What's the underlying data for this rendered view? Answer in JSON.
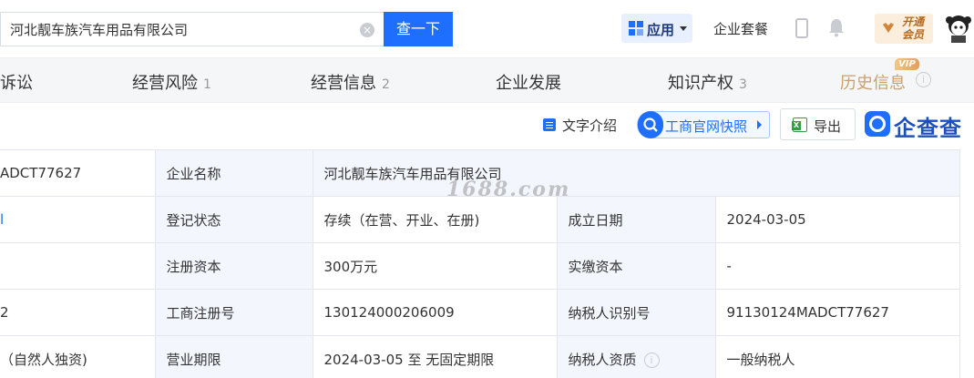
{
  "search": {
    "value": "河北靓车族汽车用品有限公司",
    "button": "查一下"
  },
  "header": {
    "app_label": "应用",
    "package_label": "企业套餐",
    "vip_label": "开通会员"
  },
  "tabs": [
    {
      "label": "诉讼",
      "count": ""
    },
    {
      "label": "经营风险",
      "count": "1"
    },
    {
      "label": "经营信息",
      "count": "2"
    },
    {
      "label": "企业发展",
      "count": ""
    },
    {
      "label": "知识产权",
      "count": "3"
    },
    {
      "label": "历史信息",
      "count": ""
    }
  ],
  "vip_tag": "VIP",
  "toolbar": {
    "text_intro": "文字介绍",
    "snapshot": "工商官网快照",
    "export": "导出",
    "brand": "企查查"
  },
  "watermark": "1688.com",
  "table": {
    "left_col": [
      "ADCT77627",
      "",
      "",
      "2",
      "（自然人独资)"
    ],
    "rows": [
      {
        "label1": "企业名称",
        "value1": "河北靓车族汽车用品有限公司",
        "label2": "",
        "value2": ""
      },
      {
        "label1": "登记状态",
        "value1": "存续（在营、开业、在册)",
        "label2": "成立日期",
        "value2": "2024-03-05"
      },
      {
        "label1": "注册资本",
        "value1": "300万元",
        "label2": "实缴资本",
        "value2": "-"
      },
      {
        "label1": "工商注册号",
        "value1": "130124000206009",
        "label2": "纳税人识别号",
        "value2": "91130124MADCT77627"
      },
      {
        "label1": "营业期限",
        "value1": "2024-03-05 至 无固定期限",
        "label2": "纳税人资质",
        "value2": "一般纳税人"
      }
    ]
  }
}
